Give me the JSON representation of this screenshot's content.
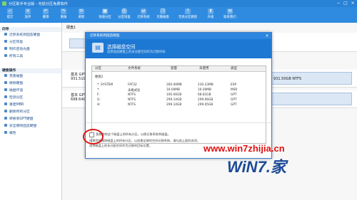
{
  "window": {
    "title": "分区助手专业版 - 无损分区免费软件",
    "buttons": [
      "−",
      "□",
      "×"
    ]
  },
  "toolbar": [
    {
      "label": "提交",
      "icon": "apply-icon"
    },
    {
      "label": "放弃",
      "icon": "discard-icon"
    },
    {
      "label": "撤销",
      "icon": "undo-icon"
    },
    {
      "label": "重做",
      "icon": "redo-icon"
    },
    {
      "label": "刷新",
      "icon": "refresh-icon"
    },
    {
      "label": "快速分区",
      "icon": "quick-partition-icon"
    },
    {
      "label": "分区恢复",
      "icon": "recover-icon"
    },
    {
      "label": "迁移系统",
      "icon": "migrate-icon"
    },
    {
      "label": "克隆磁盘",
      "icon": "clone-icon"
    },
    {
      "label": "无损分区教程",
      "icon": "tutorial-icon"
    },
    {
      "label": "升级",
      "icon": "upgrade-icon"
    },
    {
      "label": "联系我们",
      "icon": "contact-icon"
    }
  ],
  "sidebar": {
    "sections": [
      {
        "title": "向导",
        "items": [
          "迁移系统到固态硬盘",
          "分区恢复",
          "制作启动光盘",
          "所有工具"
        ]
      },
      {
        "title": "硬盘操作",
        "items": [
          "克隆磁盘",
          "擦除硬盘",
          "磁盘坏道",
          "检测分区",
          "重建MBR",
          "删除所有分区",
          "转换到GPT硬盘",
          "安全擦除固态硬盘",
          "属性"
        ]
      }
    ]
  },
  "main": {
    "disk_label_top": "硬盘1",
    "disks": [
      {
        "name": "基本 GPT",
        "size": "931.51GB"
      },
      {
        "name": "基本 GPT",
        "size": "698.64GB"
      }
    ],
    "right_label": "931.50GB NTFS"
  },
  "dialog": {
    "title": "迁移系统到固态硬盘",
    "close": "×",
    "header_title": "选择磁盘空间",
    "header_sub": "选择固态硬盘上的未分配空间作为迁移目标",
    "columns": [
      "分区",
      "文件系统",
      "容量",
      "未使用",
      "类型"
    ],
    "disk_name": "硬盘2",
    "rows": [
      [
        "*: SYSTEM",
        "FAT32",
        "260.00MB",
        "230.23MB",
        "ESP"
      ],
      [
        "*:",
        "未格式化",
        "16.00MB",
        "16.00MB",
        "MSR"
      ],
      [
        "F:",
        "NTFS",
        "100.00GB",
        "68.81GB",
        "GPT"
      ],
      [
        "G:",
        "NTFS",
        "299.14GB",
        "299.06GB",
        "GPT"
      ],
      [
        "H:",
        "NTFS",
        "299.14GB",
        "299.05GB",
        "GPT"
      ]
    ],
    "checkbox_label": "我想删除这个磁盘上的所有分区，以便迁移系统到磁盘。",
    "note_1": "如果您想删除磁盘上的所有分区，以创建足够的空间迁移系统，请勾选上面的选项。",
    "note_2": "选择磁盘上的未分配空间作为迁移的目标位置。"
  },
  "watermark": {
    "url": "www.win7zhijia.cn",
    "logo": "WiN7.家"
  }
}
